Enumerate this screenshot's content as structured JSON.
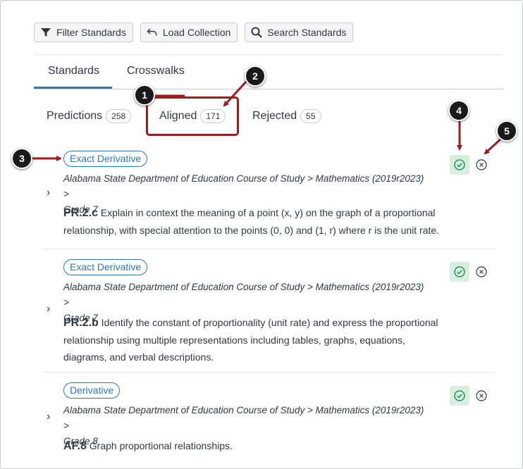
{
  "toolbar": {
    "filter_label": "Filter Standards",
    "load_label": "Load Collection",
    "search_label": "Search Standards"
  },
  "tabs": [
    {
      "label": "Standards",
      "selected": true
    },
    {
      "label": "Crosswalks",
      "selected": false
    }
  ],
  "subtabs": [
    {
      "label": "Predictions",
      "count": "258"
    },
    {
      "label": "Aligned",
      "count": "171",
      "selected": true
    },
    {
      "label": "Rejected",
      "count": "55"
    }
  ],
  "callouts": [
    "1",
    "2",
    "3",
    "4",
    "5"
  ],
  "items": [
    {
      "badge": "Exact Derivative",
      "path_line1": "Alabama State Department of Education Course of Study > Mathematics (2019r2023) >",
      "path_line2": "Grade 7",
      "code": "PR.2.c",
      "description": " Explain in context the meaning of a point (x, y) on the graph of a proportional relationship, with special attention to the points (0, 0) and (1, r) where r is the unit rate."
    },
    {
      "badge": "Exact Derivative",
      "path_line1": "Alabama State Department of Education Course of Study > Mathematics (2019r2023) >",
      "path_line2": "Grade 7",
      "code": "PR.2.b",
      "description": " Identify the constant of proportionality (unit rate) and express the proportional relationship using multiple representations including tables, graphs, equations, diagrams, and verbal descriptions."
    },
    {
      "badge": "Derivative",
      "path_line1": "Alabama State Department of Education Course of Study > Mathematics (2019r2023) >",
      "path_line2": "Grade 8",
      "code": "AF.8",
      "description": " Graph proportional relationships."
    }
  ],
  "colors": {
    "accent": "#2b7abc",
    "callout": "#9e1b1e",
    "accept_bg": "#d9eedf",
    "accept_icon": "#0b874b"
  }
}
